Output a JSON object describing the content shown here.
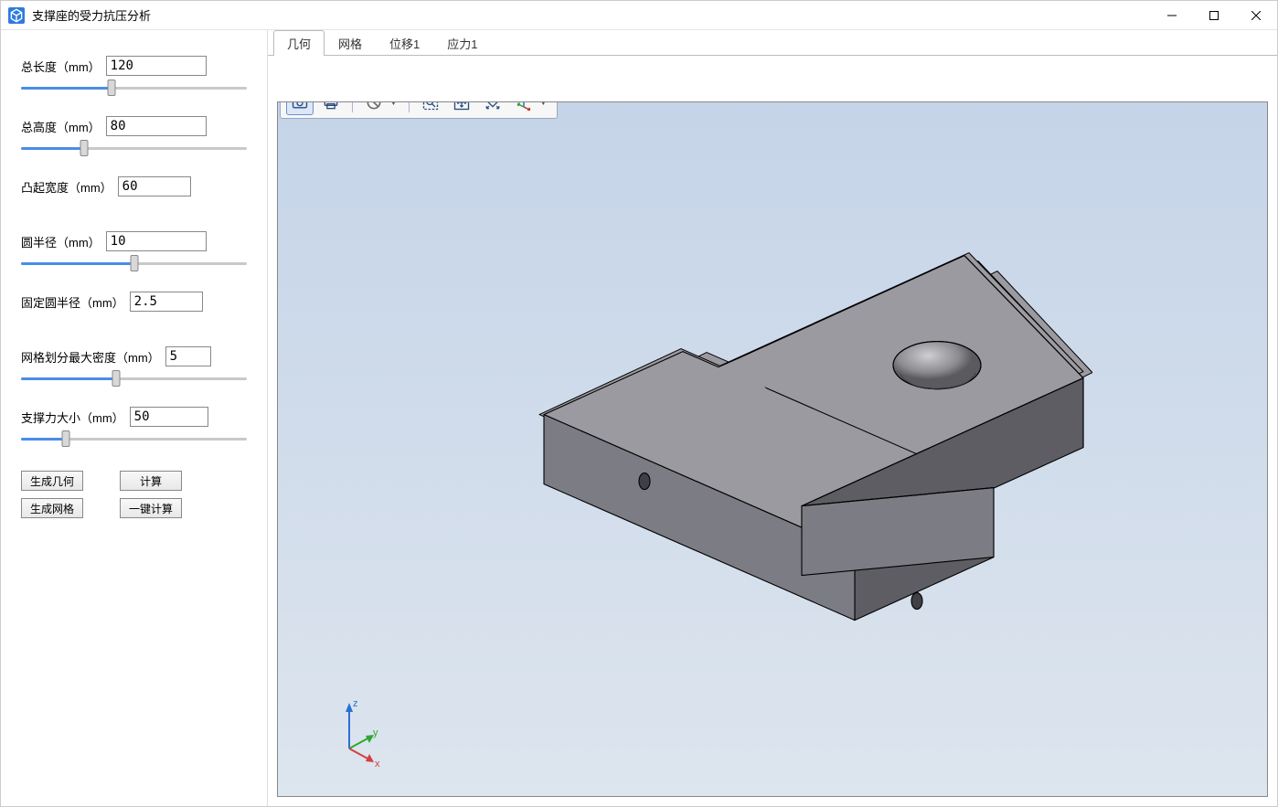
{
  "window": {
    "title": "支撑座的受力抗压分析"
  },
  "sidebar": {
    "params": [
      {
        "label": "总长度（mm）",
        "value": "120",
        "input_width": 110,
        "slider_pct": 40,
        "has_slider": true
      },
      {
        "label": "总高度（mm）",
        "value": "80",
        "input_width": 110,
        "slider_pct": 28,
        "has_slider": true
      },
      {
        "label": "凸起宽度（mm）",
        "value": "60",
        "input_width": 80,
        "slider_pct": 0,
        "has_slider": false
      },
      {
        "label": "圆半径（mm）",
        "value": "10",
        "input_width": 110,
        "slider_pct": 50,
        "has_slider": true
      },
      {
        "label": "固定圆半径（mm）",
        "value": "2.5",
        "input_width": 80,
        "slider_pct": 0,
        "has_slider": false
      },
      {
        "label": "网格划分最大密度（mm）",
        "value": "5",
        "input_width": 50,
        "slider_pct": 42,
        "has_slider": true
      },
      {
        "label": "支撑力大小（mm）",
        "value": "50",
        "input_width": 86,
        "slider_pct": 20,
        "has_slider": true
      }
    ],
    "buttons": {
      "gen_geom": "生成几何",
      "compute": "计算",
      "gen_mesh": "生成网格",
      "one_click": "一键计算"
    }
  },
  "tabs": [
    {
      "label": "几何",
      "active": true
    },
    {
      "label": "网格",
      "active": false
    },
    {
      "label": "位移1",
      "active": false
    },
    {
      "label": "应力1",
      "active": false
    }
  ],
  "axis_labels": {
    "x": "x",
    "y": "y",
    "z": "z"
  }
}
